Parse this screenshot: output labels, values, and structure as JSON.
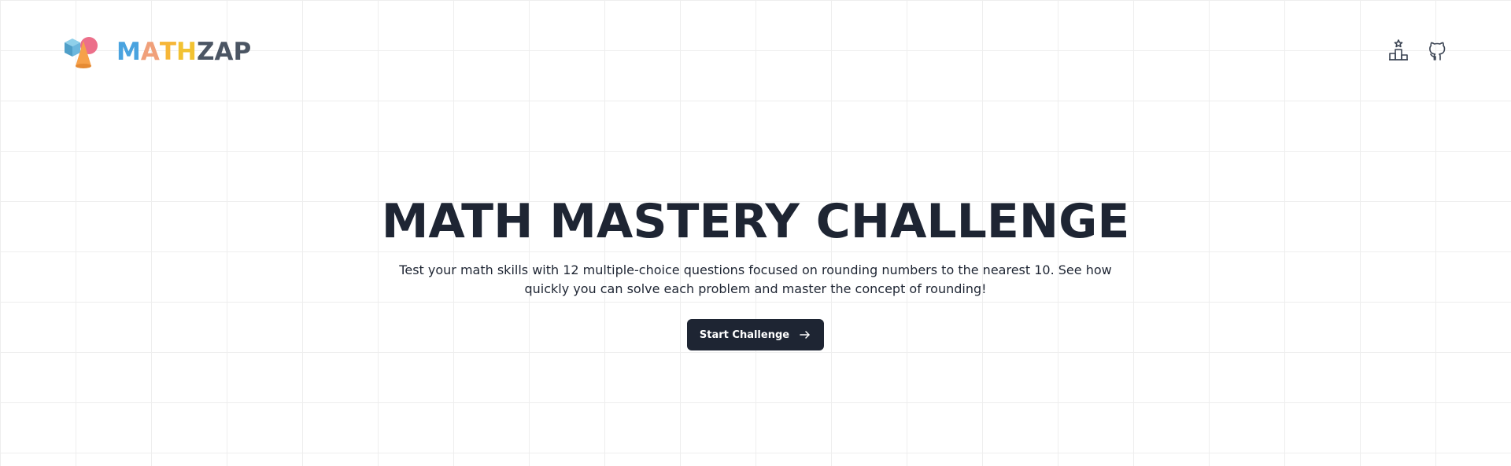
{
  "header": {
    "logo": {
      "letters": [
        {
          "char": "M",
          "color": "#4aa3df"
        },
        {
          "char": "A",
          "color": "#f0a07a"
        },
        {
          "char": "T",
          "color": "#f6b637"
        },
        {
          "char": "H",
          "color": "#f2c232"
        },
        {
          "char": "Z",
          "color": "#4b5563"
        },
        {
          "char": "A",
          "color": "#4b5563"
        },
        {
          "char": "P",
          "color": "#4b5563"
        }
      ],
      "mark_icon": "geometric-shapes-logo-icon"
    },
    "nav": [
      {
        "icon": "leaderboard-icon"
      },
      {
        "icon": "github-icon"
      }
    ]
  },
  "hero": {
    "title": "MATH MASTERY CHALLENGE",
    "description": "Test your math skills with 12 multiple-choice questions focused on rounding numbers to the nearest 10. See how quickly you can solve each problem and master the concept of rounding!",
    "cta_label": "Start Challenge",
    "cta_icon": "arrow-right-icon"
  },
  "colors": {
    "text": "#1e2533",
    "button_bg": "#1e2533",
    "grid_line": "#eeeeee",
    "background": "#ffffff"
  }
}
